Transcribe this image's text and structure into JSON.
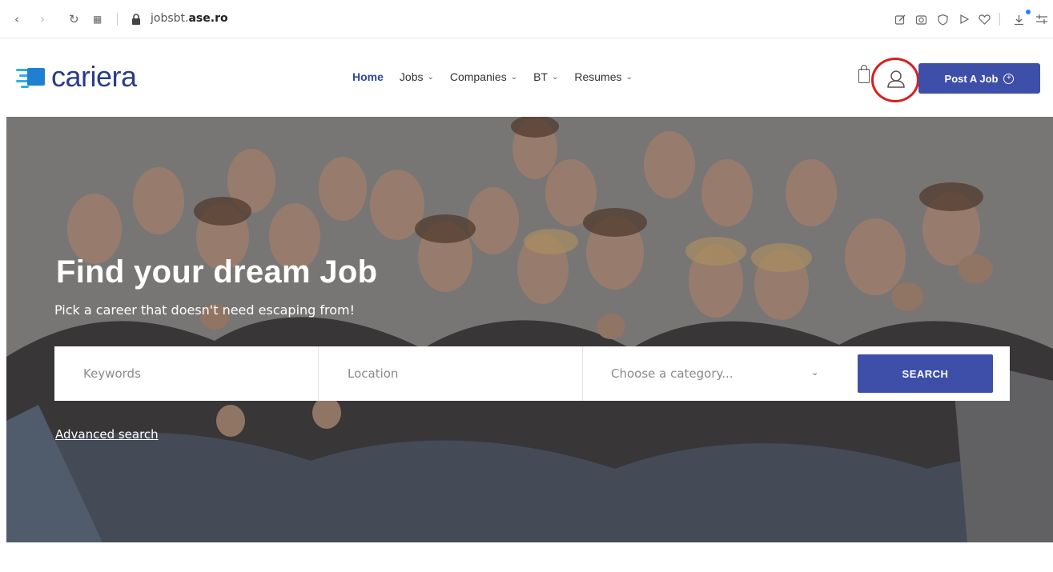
{
  "browser": {
    "url_prefix": "jobsbt.",
    "url_domain": "ase.ro",
    "icons": [
      "back-icon",
      "forward-icon",
      "reload-icon",
      "apps-icon",
      "lock-icon",
      "edit-icon",
      "camera-icon",
      "shield-icon",
      "play-icon",
      "heart-icon",
      "download-icon",
      "menu-icon"
    ]
  },
  "header": {
    "logo_text": "cariera",
    "nav": [
      {
        "label": "Home",
        "active": true,
        "dropdown": false
      },
      {
        "label": "Jobs",
        "active": false,
        "dropdown": true
      },
      {
        "label": "Companies",
        "active": false,
        "dropdown": true
      },
      {
        "label": "BT",
        "active": false,
        "dropdown": true
      },
      {
        "label": "Resumes",
        "active": false,
        "dropdown": true
      }
    ],
    "post_job_label": "Post A Job",
    "accent_color": "#3e4fa9",
    "highlight_color": "#d91e1e"
  },
  "hero": {
    "title": "Find your dream Job",
    "subtitle": "Pick a career that doesn't need escaping from!",
    "search": {
      "keywords_placeholder": "Keywords",
      "location_placeholder": "Location",
      "category_placeholder": "Choose a category...",
      "button_label": "SEARCH"
    },
    "advanced_search_label": "Advanced search"
  }
}
